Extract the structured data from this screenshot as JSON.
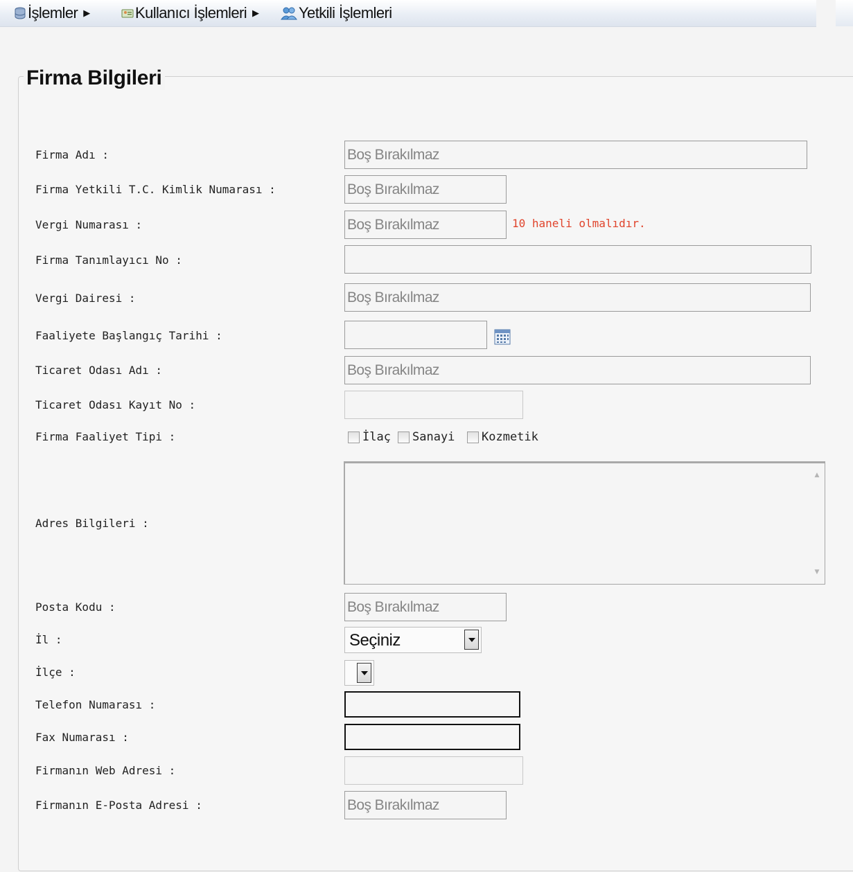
{
  "menu": {
    "items": [
      {
        "label": "İşlemler",
        "icon": "database-icon"
      },
      {
        "label": "Kullanıcı İşlemleri",
        "icon": "users-card-icon"
      },
      {
        "label": "Yetkili İşlemleri",
        "icon": "people-icon"
      }
    ]
  },
  "form": {
    "legend": "Firma Bilgileri",
    "labels": {
      "firma_adi": "Firma Adı :",
      "tc_kimlik": "Firma Yetkili T.C. Kimlik Numarası :",
      "vergi_no": "Vergi Numarası :",
      "tanimlayici": "Firma Tanımlayıcı No :",
      "vergi_dairesi": "Vergi Dairesi :",
      "baslangic": "Faaliyete Başlangıç Tarihi :",
      "ticaret_odasi": "Ticaret Odası Adı :",
      "oda_kayit": "Ticaret Odası Kayıt No :",
      "faaliyet_tipi": "Firma Faaliyet Tipi :",
      "adres": "Adres Bilgileri :",
      "posta_kodu": "Posta Kodu :",
      "il": "İl :",
      "ilce": "İlçe :",
      "telefon": "Telefon Numarası :",
      "fax": "Fax Numarası :",
      "web": "Firmanın Web Adresi :",
      "eposta": "Firmanın E-Posta Adresi :"
    },
    "placeholder": "Boş Bırakılmaz",
    "vergi_no_error": "10 haneli olmalıdır.",
    "activity_types": [
      "İlaç",
      "Sanayi",
      "Kozmetik"
    ],
    "il_selected": "Seçiniz",
    "ilce_selected": ""
  },
  "colors": {
    "error": "#e0442c",
    "menubar": "#e9eef5"
  }
}
